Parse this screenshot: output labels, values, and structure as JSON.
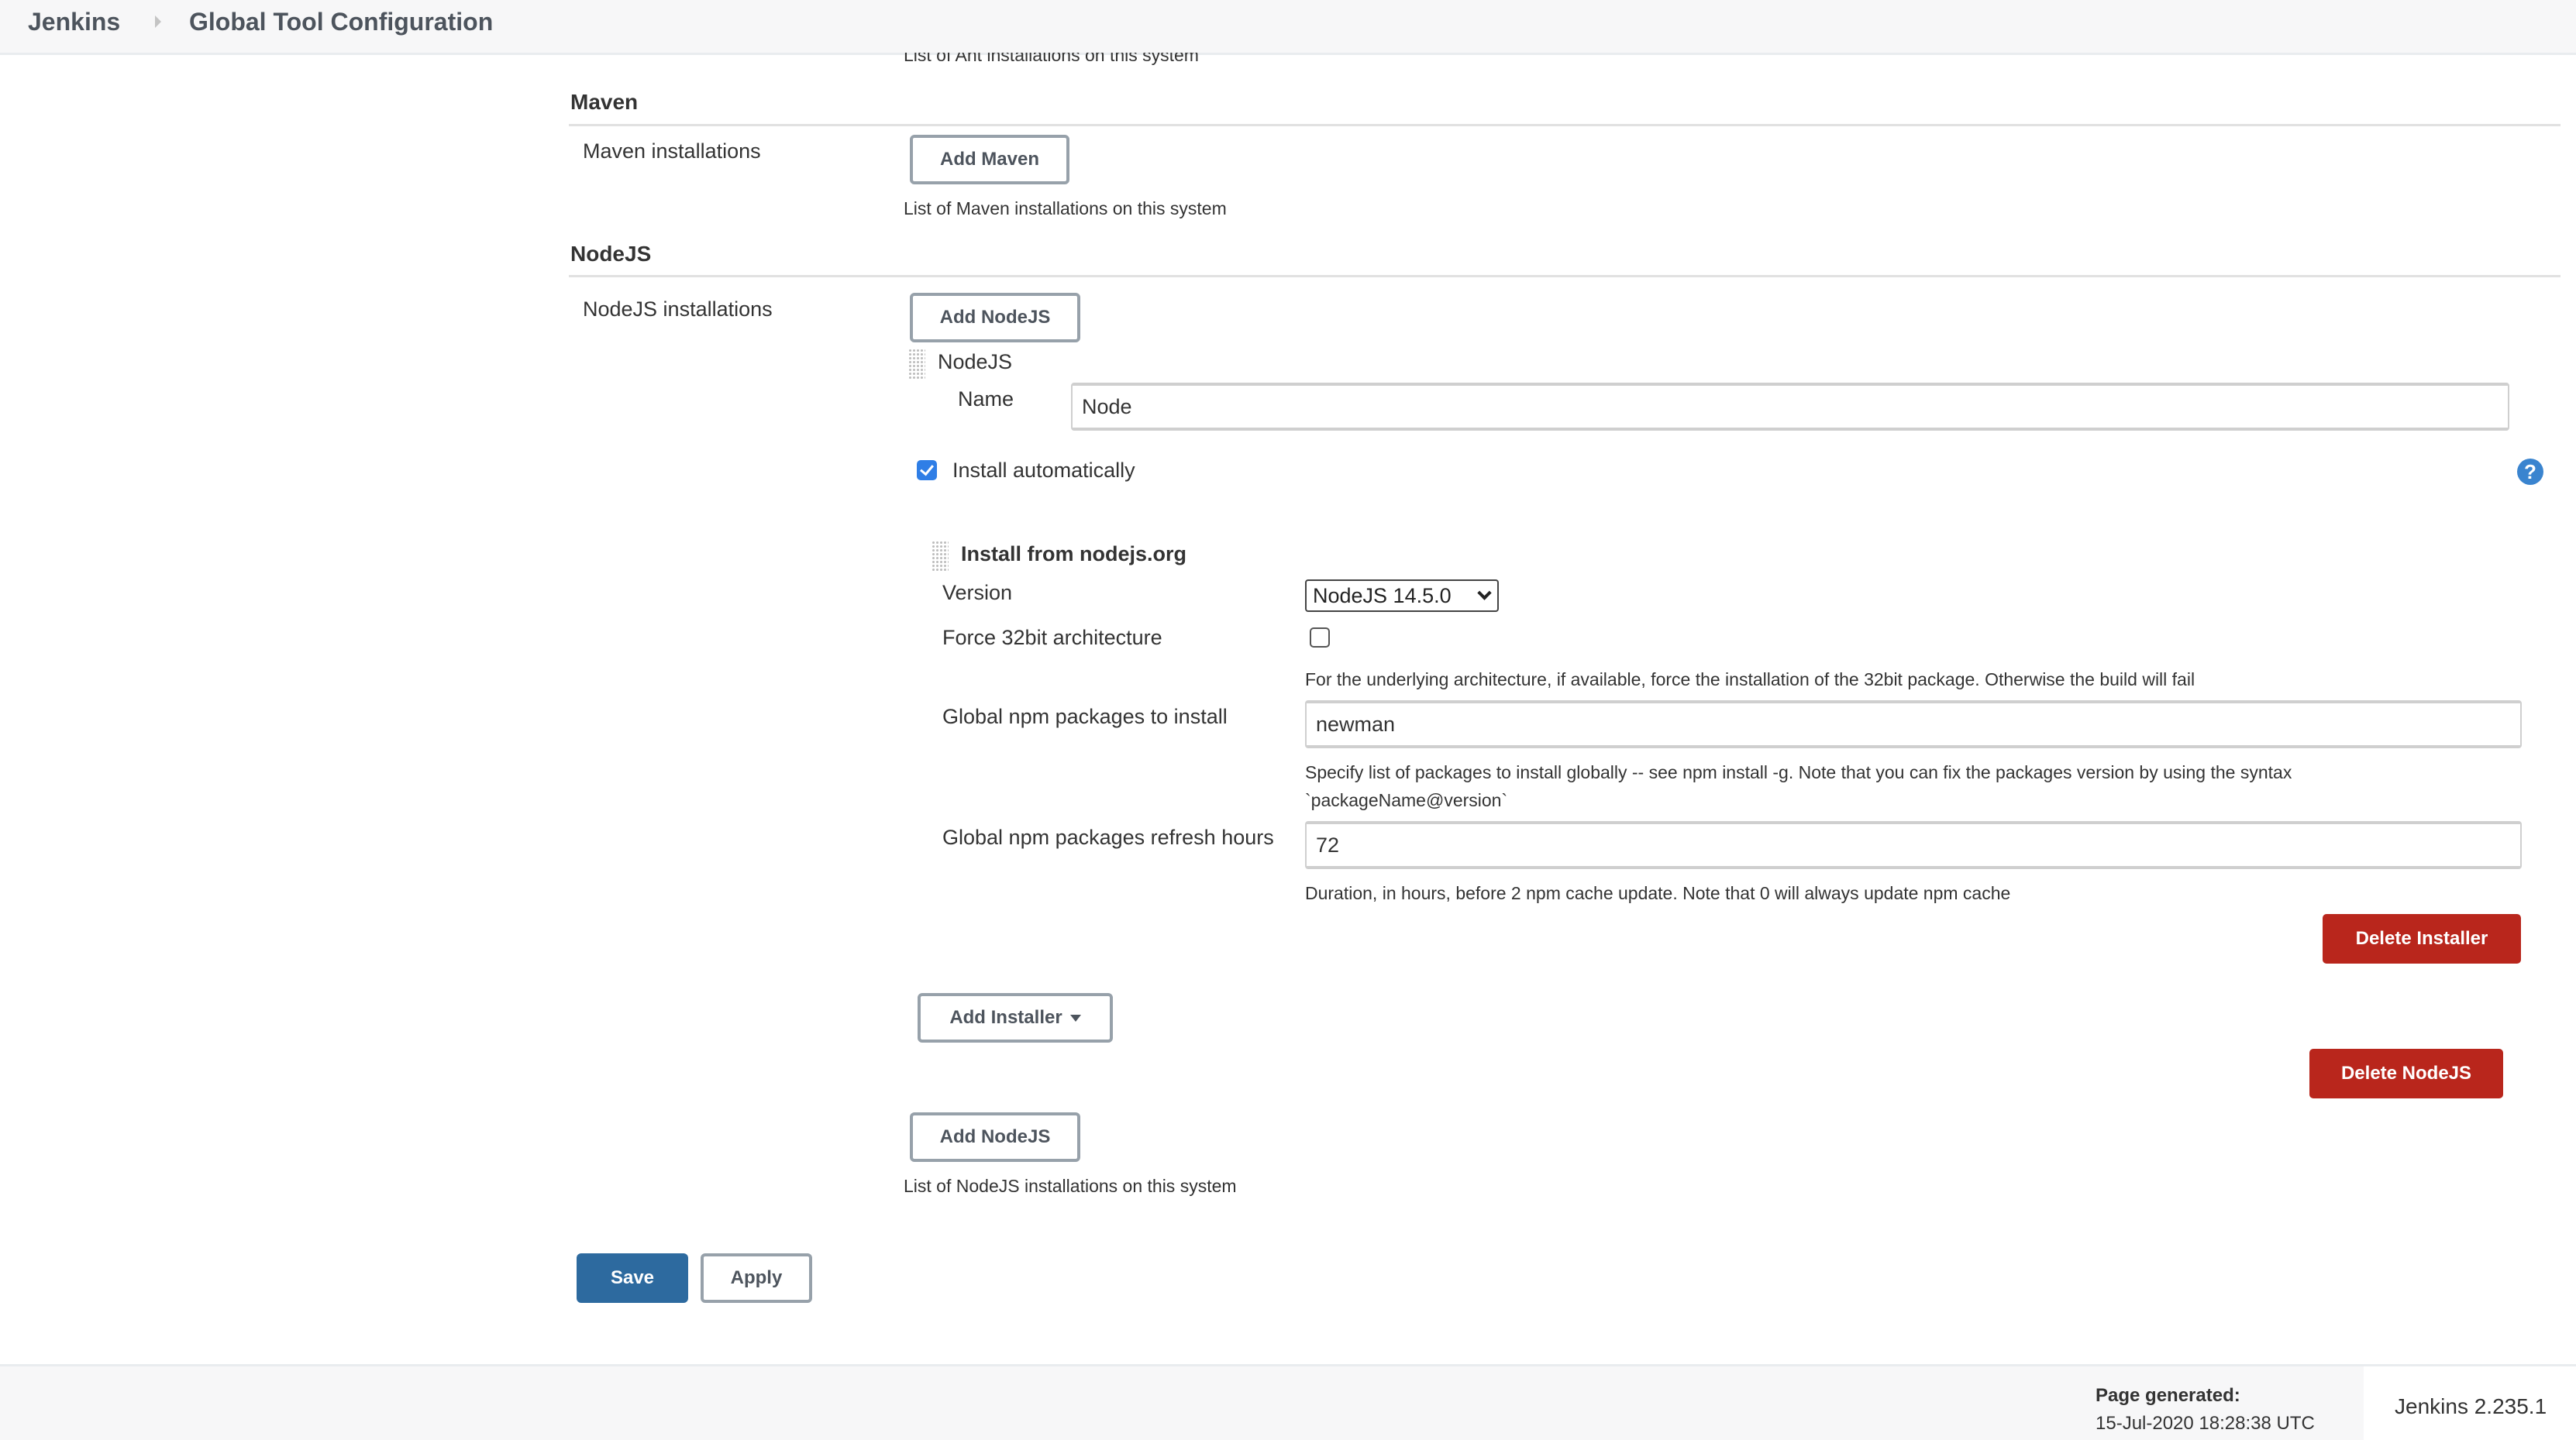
{
  "breadcrumb": {
    "root": "Jenkins",
    "current": "Global Tool Configuration"
  },
  "ant": {
    "description": "List of Ant installations on this system"
  },
  "maven": {
    "title": "Maven",
    "label": "Maven installations",
    "add_button": "Add Maven",
    "description": "List of Maven installations on this system"
  },
  "nodejs": {
    "title": "NodeJS",
    "label": "NodeJS installations",
    "add_button": "Add NodeJS",
    "installation": {
      "header": "NodeJS",
      "name_label": "Name",
      "name_value": "Node",
      "install_automatically_label": "Install automatically",
      "install_automatically_checked": true,
      "installer": {
        "title": "Install from nodejs.org",
        "version_label": "Version",
        "version_selected": "NodeJS 14.5.0",
        "force32_label": "Force 32bit architecture",
        "force32_checked": false,
        "force32_description": "For the underlying architecture, if available, force the installation of the 32bit package. Otherwise the build will fail",
        "npm_packages_label": "Global npm packages to install",
        "npm_packages_value": "newman",
        "npm_packages_description_line1": "Specify list of packages to install globally -- see npm install -g. Note that you can fix the packages version by using the syntax",
        "npm_packages_description_line2": "`packageName@version`",
        "refresh_label": "Global npm packages refresh hours",
        "refresh_value": "72",
        "refresh_description": "Duration, in hours, before 2 npm cache update. Note that 0 will always update npm cache",
        "delete_button": "Delete Installer"
      },
      "add_installer_button": "Add Installer",
      "delete_button": "Delete NodeJS"
    },
    "add_button_bottom": "Add NodeJS",
    "description": "List of NodeJS installations on this system"
  },
  "actions": {
    "save": "Save",
    "apply": "Apply"
  },
  "footer": {
    "generated_label": "Page generated:",
    "generated_time": "15-Jul-2020 18:28:38 UTC",
    "version": "Jenkins 2.235.1"
  },
  "icons": {
    "breadcrumb_separator": "chevron-right-icon",
    "help": "help-icon",
    "drag_handle": "drag-handle-icon",
    "dropdown": "caret-down-icon"
  },
  "colors": {
    "primary": "#2d6a9f",
    "danger": "#b9261c",
    "checkbox": "#2f7ee6",
    "help": "#3a84cf"
  }
}
